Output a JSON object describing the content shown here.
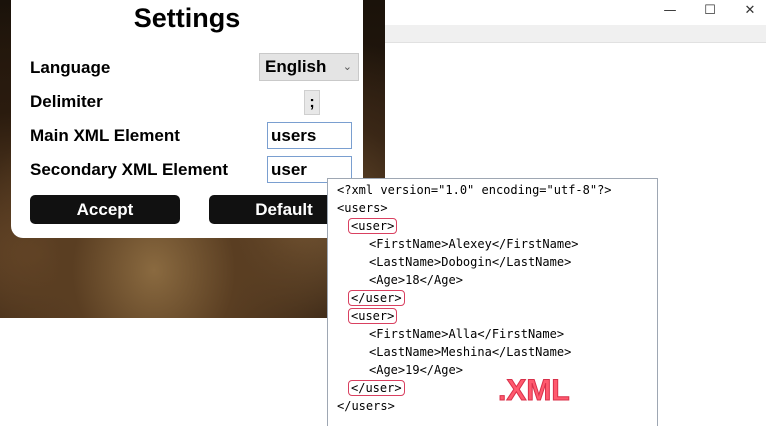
{
  "background_window": {
    "controls": {
      "minimize": "—",
      "maximize": "☐",
      "close": "✕"
    }
  },
  "settings": {
    "title": "Settings",
    "language_label": "Language",
    "language_value": "English",
    "delimiter_label": "Delimiter",
    "delimiter_value": ";",
    "main_element_label": "Main XML Element",
    "main_element_value": "users",
    "secondary_element_label": "Secondary XML Element",
    "secondary_element_value": "user",
    "accept_label": "Accept",
    "default_label": "Default"
  },
  "xml_sample": {
    "lines": [
      "<?xml version=\"1.0\" encoding=\"utf-8\"?>",
      "<users>",
      "<user>",
      "<FirstName>Alexey</FirstName>",
      "<LastName>Dobogin</LastName>",
      "<Age>18</Age>",
      "</user>",
      "<user>",
      "<FirstName>Alla</FirstName>",
      "<LastName>Meshina</LastName>",
      "<Age>19</Age>",
      "</user>",
      "</users>"
    ],
    "badge": ".XML"
  },
  "colors": {
    "highlight": "#d94060",
    "badge": "#ff5a6e",
    "button_bg": "#111111"
  }
}
